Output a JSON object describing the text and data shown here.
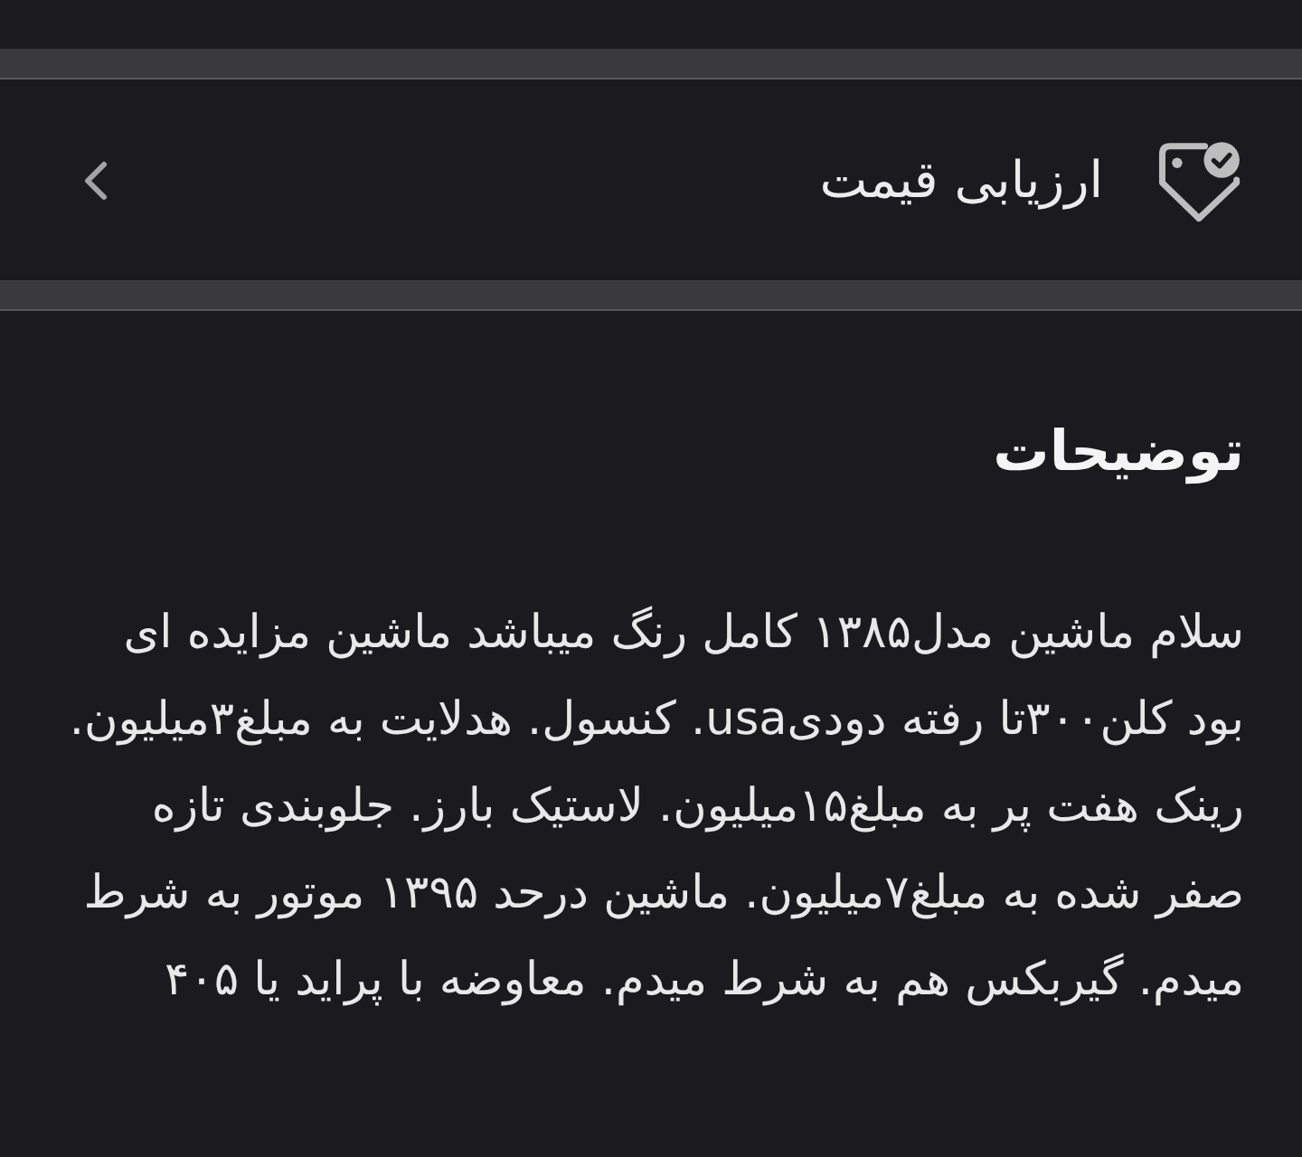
{
  "menu_item": {
    "label": "ارزیابی قیمت"
  },
  "description": {
    "heading": "توضیحات",
    "text": "سلام ماشین مدل۱۳۸۵ کامل رنگ میباشد ماشین مزایده ای بود کلن۳۰۰تا رفته دودیusa. کنسول. هدلایت به مبلغ۳میلیون. رینک هفت پر به مبلغ۱۵میلیون. لاستیک بارز. جلوبندی تازه صفر شده به مبلغ۷میلیون. ماشین درحد ۱۳۹۵ موتور به شرط میدم. گیربکس هم به شرط میدم. معاوضه با پراید یا ۴۰۵"
  }
}
